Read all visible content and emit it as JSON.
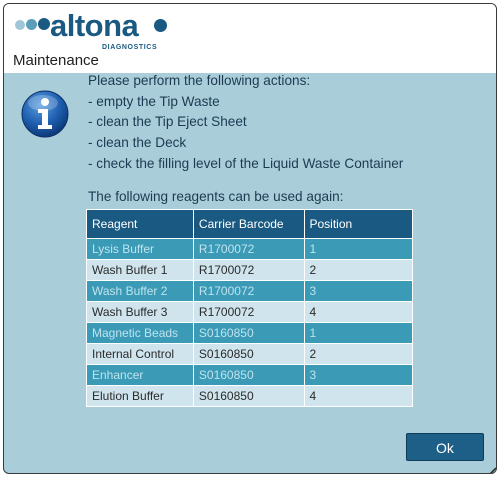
{
  "brand": {
    "wordmark": "altona",
    "subtitle": "DIAGNOSTICS",
    "dot_colors": [
      "#9ec6d6",
      "#5b9dbb",
      "#1a5a82",
      "#1a5a82"
    ]
  },
  "dialog": {
    "title": "Maintenance",
    "icon": "info-icon"
  },
  "messages": [
    "Please perform the following actions:",
    "- empty the Tip Waste",
    "- clean the Tip Eject Sheet",
    "- clean the Deck",
    "- check the filling level of the Liquid Waste Container"
  ],
  "reagents": {
    "heading": "The following reagents can be used again:",
    "columns": [
      "Reagent",
      "Carrier Barcode",
      "Position"
    ],
    "rows": [
      {
        "reagent": "Lysis Buffer",
        "barcode": "R1700072",
        "position": "1"
      },
      {
        "reagent": "Wash Buffer 1",
        "barcode": "R1700072",
        "position": "2"
      },
      {
        "reagent": "Wash Buffer 2",
        "barcode": "R1700072",
        "position": "3"
      },
      {
        "reagent": "Wash Buffer 3",
        "barcode": "R1700072",
        "position": "4"
      },
      {
        "reagent": "Magnetic Beads",
        "barcode": "S0160850",
        "position": "1"
      },
      {
        "reagent": "Internal Control",
        "barcode": "S0160850",
        "position": "2"
      },
      {
        "reagent": "Enhancer",
        "barcode": "S0160850",
        "position": "3"
      },
      {
        "reagent": "Elution Buffer",
        "barcode": "S0160850",
        "position": "4"
      }
    ]
  },
  "buttons": {
    "ok_label": "Ok"
  },
  "colors": {
    "accent": "#1a5a82",
    "panel_background": "#a9cdd9",
    "row_dark": "#3b9ab6",
    "row_light": "#cfe4ec"
  }
}
